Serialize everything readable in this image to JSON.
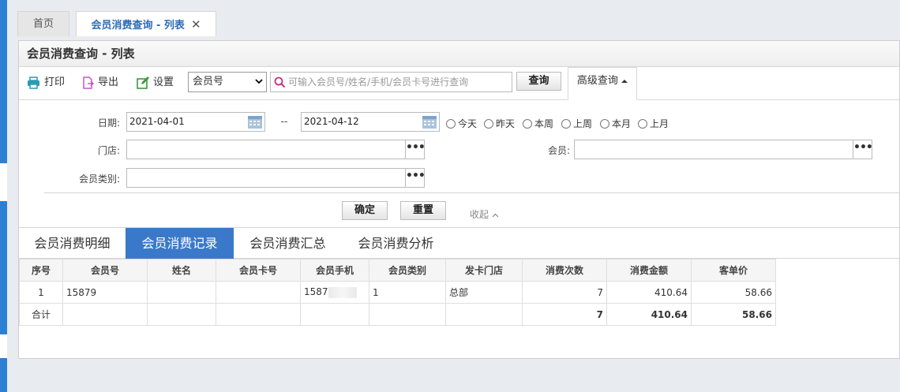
{
  "tabs": [
    {
      "label": "首页"
    },
    {
      "label": "会员消费查询 - 列表",
      "close": "✕"
    }
  ],
  "panel": {
    "title": "会员消费查询 - 列表"
  },
  "toolbar": {
    "print": "打印",
    "export": "导出",
    "settings": "设置",
    "field_select": "会员号",
    "search_placeholder": "可输入会员号/姓名/手机/会员卡号进行查询",
    "query": "查询",
    "advanced": "高级查询"
  },
  "filter": {
    "date_label": "日期:",
    "date_from": "2021-04-01",
    "date_sep": "--",
    "date_to": "2021-04-12",
    "ranges": [
      "今天",
      "昨天",
      "本周",
      "上周",
      "本月",
      "上月"
    ],
    "store_label": "门店:",
    "member_label": "会员:",
    "category_label": "会员类别:",
    "dots": "•••",
    "confirm": "确定",
    "reset": "重置",
    "collapse": "收起"
  },
  "subtabs": [
    "会员消费明细",
    "会员消费记录",
    "会员消费汇总",
    "会员消费分析"
  ],
  "table": {
    "headers": [
      "序号",
      "会员号",
      "姓名",
      "会员卡号",
      "会员手机",
      "会员类别",
      "发卡门店",
      "消费次数",
      "消费金额",
      "客单价"
    ],
    "row": {
      "no": "1",
      "member_no": "15879",
      "name": "",
      "card_no": "",
      "phone": "1587",
      "category": "1",
      "store": "总部",
      "count": "7",
      "amount": "410.64",
      "avg": "58.66"
    },
    "sum": {
      "label": "合计",
      "count": "7",
      "amount": "410.64",
      "avg": "58.66"
    }
  }
}
